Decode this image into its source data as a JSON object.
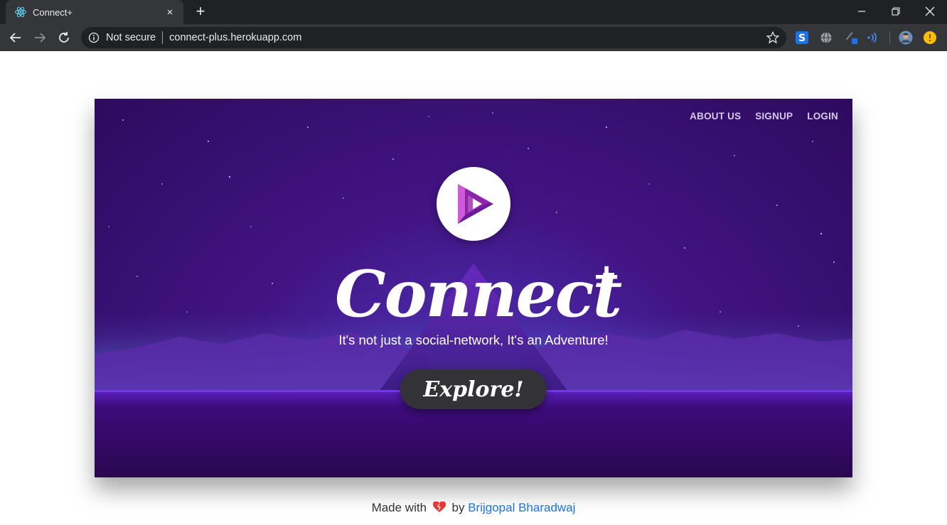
{
  "browser": {
    "tab_title": "Connect+",
    "tab_close_icon": "×",
    "new_tab_icon": "+",
    "security_label": "Not secure",
    "url": "connect-plus.herokuapp.com"
  },
  "nav": {
    "about": "ABOUT US",
    "signup": "SIGNUP",
    "login": "LOGIN"
  },
  "hero": {
    "brand": "Connect",
    "brand_plus": "+",
    "tagline": "It's not just a social-network, It's an Adventure!",
    "cta": "Explore!"
  },
  "footer": {
    "made_with": "Made with",
    "by": "by",
    "author": "Brijgopal Bharadwaj"
  },
  "colors": {
    "accent_purple": "#421585",
    "button_bg": "#333236",
    "link_blue": "#1a73e8"
  },
  "icons": [
    "react-favicon-icon",
    "back-arrow-icon",
    "forward-arrow-icon",
    "reload-icon",
    "info-icon",
    "star-icon",
    "heart-icon",
    "play-triangle-logo-icon"
  ]
}
